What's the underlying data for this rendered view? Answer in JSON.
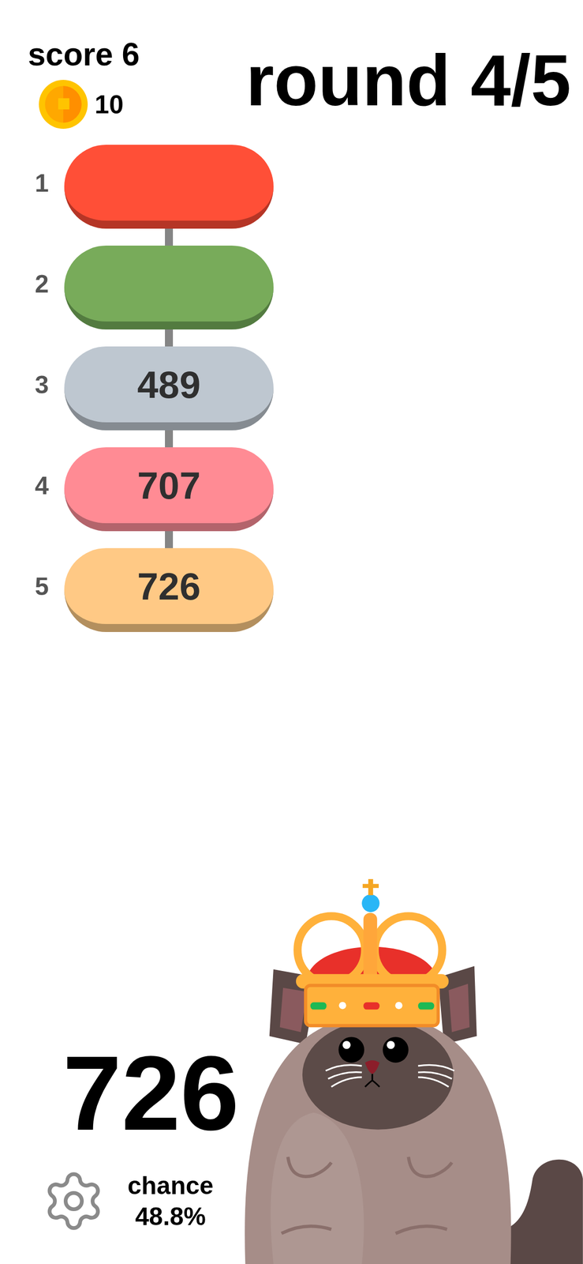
{
  "score": {
    "label": "score 6"
  },
  "coins": {
    "count": "10"
  },
  "round": {
    "label": "round 4/5"
  },
  "slots": [
    {
      "index": "1",
      "value": "",
      "filled": false,
      "color": "#ff4f37",
      "shade": "#b53526"
    },
    {
      "index": "2",
      "value": "",
      "filled": false,
      "color": "#78ab5a",
      "shade": "#537b40"
    },
    {
      "index": "3",
      "value": "489",
      "filled": true,
      "color": "#bec7d0",
      "shade": "#858b91"
    },
    {
      "index": "4",
      "value": "707",
      "filled": true,
      "color": "#ff8b94",
      "shade": "#b3646b"
    },
    {
      "index": "5",
      "value": "726",
      "filled": true,
      "color": "#ffc985",
      "shade": "#b38f5e"
    }
  ],
  "current": {
    "value": "726"
  },
  "chance": {
    "label": "chance",
    "value": "48.8%"
  }
}
